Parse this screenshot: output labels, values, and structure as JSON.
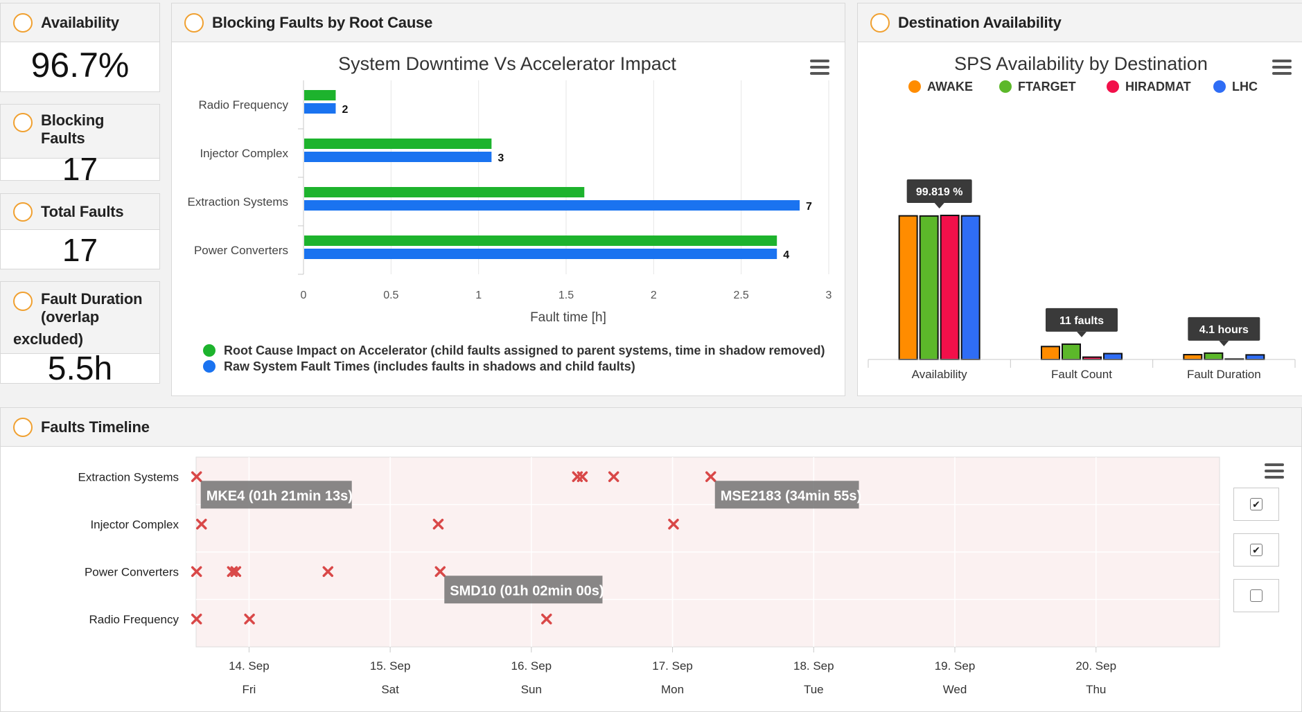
{
  "kpis": {
    "availability": {
      "title": "Availability",
      "value": "96.7%"
    },
    "blocking_faults": {
      "title_line1": "Blocking",
      "title_line2": "Faults",
      "value": "17"
    },
    "total_faults": {
      "title": "Total Faults",
      "value": "17"
    },
    "fault_duration": {
      "title_line1": "Fault Duration",
      "title_line2": "(overlap",
      "title_line3": "excluded)",
      "value": "5.5h"
    }
  },
  "blocking_panel": {
    "title": "Blocking Faults by Root Cause",
    "chart_title": "System Downtime Vs Accelerator Impact",
    "xlabel": "Fault time [h]",
    "legend": [
      {
        "label": "Root Cause Impact on Accelerator (child faults assigned to parent systems, time in shadow removed)",
        "color": "#1db32d"
      },
      {
        "label": "Raw System Fault Times (includes faults in shadows and child faults)",
        "color": "#1a73f0"
      }
    ]
  },
  "destination_panel": {
    "title": "Destination Availability",
    "chart_title": "SPS Availability by Destination"
  },
  "timeline_panel": {
    "title": "Faults Timeline",
    "checkboxes": [
      {
        "checked": true,
        "mark": "✔"
      },
      {
        "checked": true,
        "mark": "✔"
      },
      {
        "checked": false,
        "mark": ""
      }
    ]
  },
  "chart_data": [
    {
      "type": "bar",
      "orientation": "horizontal",
      "title": "System Downtime Vs Accelerator Impact",
      "xlabel": "Fault time [h]",
      "categories": [
        "Radio Frequency",
        "Injector Complex",
        "Extraction Systems",
        "Power Converters"
      ],
      "series": [
        {
          "name": "Root Cause Impact on Accelerator (child faults assigned to parent systems, time in shadow removed)",
          "color": "#1db32d",
          "values": [
            0.18,
            1.07,
            1.6,
            2.7
          ]
        },
        {
          "name": "Raw System Fault Times (includes faults in shadows and child faults)",
          "color": "#1a73f0",
          "values": [
            0.18,
            1.07,
            2.83,
            2.7
          ],
          "data_labels": [
            "2",
            "3",
            "7",
            "4"
          ]
        }
      ],
      "xlim": [
        0,
        3
      ],
      "xticks": [
        "0",
        "0.5",
        "1",
        "1.5",
        "2",
        "2.5",
        "3"
      ],
      "grid": true,
      "legend_position": "bottom"
    },
    {
      "type": "bar",
      "title": "SPS Availability by Destination",
      "categories": [
        "Availability",
        "Fault Count",
        "Fault Duration"
      ],
      "series": [
        {
          "name": "AWAKE",
          "color": "#ff8c00",
          "values": [
            99.7,
            11,
            4.1
          ]
        },
        {
          "name": "FTARGET",
          "color": "#5cb82a",
          "values": [
            99.6,
            13,
            5.4
          ]
        },
        {
          "name": "HIRADMAT",
          "color": "#f2104a",
          "values": [
            100,
            2,
            0.4
          ]
        },
        {
          "name": "LHC",
          "color": "#2f6df5",
          "values": [
            99.7,
            5,
            3.9
          ]
        }
      ],
      "ymax": [
        100,
        100,
        100
      ],
      "tooltips": [
        {
          "category": "Availability",
          "text": "99.819 %"
        },
        {
          "category": "Fault Count",
          "text": "11 faults"
        },
        {
          "category": "Fault Duration",
          "text": "4.1 hours"
        }
      ],
      "legend_position": "top",
      "grid": false
    },
    {
      "type": "scatter",
      "categories": [
        "Extraction Systems",
        "Injector Complex",
        "Power Converters",
        "Radio Frequency"
      ],
      "x_ticks": [
        {
          "date": "14. Sep",
          "day": "Fri"
        },
        {
          "date": "15. Sep",
          "day": "Sat"
        },
        {
          "date": "16. Sep",
          "day": "Sun"
        },
        {
          "date": "17. Sep",
          "day": "Mon"
        },
        {
          "date": "18. Sep",
          "day": "Tue"
        },
        {
          "date": "19. Sep",
          "day": "Wed"
        },
        {
          "date": "20. Sep",
          "day": "Thu"
        }
      ],
      "xlim": [
        "2018-09-13 15:00",
        "2018-09-20 21:00"
      ],
      "points": [
        {
          "category": "Extraction Systems",
          "t": "2018-09-13 15:05"
        },
        {
          "category": "Extraction Systems",
          "t": "2018-09-16 07:50"
        },
        {
          "category": "Extraction Systems",
          "t": "2018-09-16 08:40"
        },
        {
          "category": "Extraction Systems",
          "t": "2018-09-16 14:00"
        },
        {
          "category": "Extraction Systems",
          "t": "2018-09-17 06:30"
        },
        {
          "category": "Injector Complex",
          "t": "2018-09-13 15:55"
        },
        {
          "category": "Injector Complex",
          "t": "2018-09-15 08:10"
        },
        {
          "category": "Injector Complex",
          "t": "2018-09-17 00:10"
        },
        {
          "category": "Power Converters",
          "t": "2018-09-13 15:05"
        },
        {
          "category": "Power Converters",
          "t": "2018-09-13 21:10"
        },
        {
          "category": "Power Converters",
          "t": "2018-09-13 21:45"
        },
        {
          "category": "Power Converters",
          "t": "2018-09-14 13:25"
        },
        {
          "category": "Power Converters",
          "t": "2018-09-15 08:30"
        },
        {
          "category": "Radio Frequency",
          "t": "2018-09-13 15:05"
        },
        {
          "category": "Radio Frequency",
          "t": "2018-09-14 00:05"
        },
        {
          "category": "Radio Frequency",
          "t": "2018-09-16 02:35"
        }
      ],
      "labels": [
        {
          "category": "Extraction Systems",
          "t": "2018-09-13 15:05",
          "text": "MKE4 (01h 21min 13s)"
        },
        {
          "category": "Extraction Systems",
          "t": "2018-09-17 06:30",
          "text": "MSE2183 (34min 55s)"
        },
        {
          "category": "Power Converters",
          "t": "2018-09-15 08:30",
          "text": "SMD10 (01h 02min 00s)"
        }
      ],
      "grid": true
    }
  ]
}
